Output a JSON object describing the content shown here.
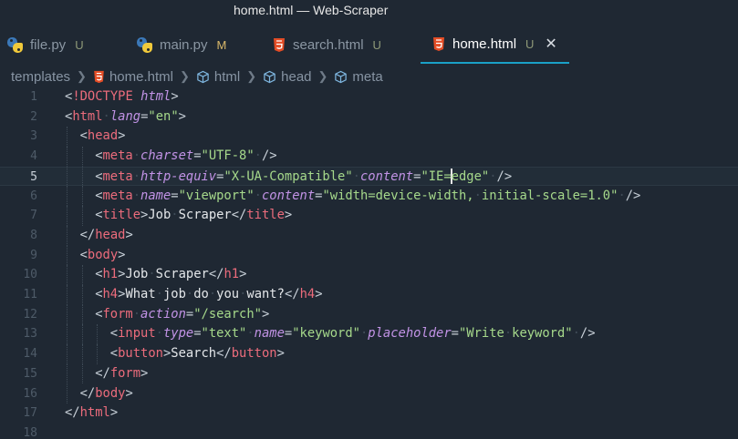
{
  "window": {
    "title": "home.html — Web-Scraper"
  },
  "tabs": [
    {
      "label": "file.py",
      "status": "U",
      "icon": "python-icon"
    },
    {
      "label": "main.py",
      "status": "M",
      "icon": "python-icon"
    },
    {
      "label": "search.html",
      "status": "U",
      "icon": "html5-icon"
    },
    {
      "label": "home.html",
      "status": "U",
      "icon": "html5-icon",
      "active": true
    }
  ],
  "breadcrumb": [
    "templates",
    "home.html",
    "html",
    "head",
    "meta"
  ],
  "colors": {
    "tag": "#ec6c7c",
    "attribute": "#c293e6",
    "string": "#a6d98b",
    "active_tab_underline": "#1aa0c7",
    "html5_orange": "#e44d26"
  },
  "editor": {
    "current_line": 5,
    "lines": [
      {
        "n": "1",
        "indent": 0,
        "tokens": [
          [
            "p",
            "<"
          ],
          [
            "t",
            "!DOCTYPE"
          ],
          [
            "p",
            " "
          ],
          [
            "a",
            "html"
          ],
          [
            "p",
            ">"
          ]
        ]
      },
      {
        "n": "2",
        "indent": 0,
        "tokens": [
          [
            "p",
            "<"
          ],
          [
            "t",
            "html"
          ],
          [
            "ws",
            "·"
          ],
          [
            "a",
            "lang"
          ],
          [
            "p",
            "="
          ],
          [
            "s",
            "\"en\""
          ],
          [
            "p",
            ">"
          ]
        ]
      },
      {
        "n": "3",
        "indent": 1,
        "tokens": [
          [
            "p",
            "<"
          ],
          [
            "t",
            "head"
          ],
          [
            "p",
            ">"
          ]
        ]
      },
      {
        "n": "4",
        "indent": 2,
        "tokens": [
          [
            "p",
            "<"
          ],
          [
            "t",
            "meta"
          ],
          [
            "ws",
            "·"
          ],
          [
            "a",
            "charset"
          ],
          [
            "p",
            "="
          ],
          [
            "s",
            "\"UTF-8\""
          ],
          [
            "ws",
            "·"
          ],
          [
            "p",
            "/>"
          ]
        ]
      },
      {
        "n": "5",
        "indent": 2,
        "tokens": [
          [
            "p",
            "<"
          ],
          [
            "t",
            "meta"
          ],
          [
            "ws",
            "·"
          ],
          [
            "a",
            "http-equiv"
          ],
          [
            "p",
            "="
          ],
          [
            "s",
            "\"X-UA-Compatible\""
          ],
          [
            "ws",
            "·"
          ],
          [
            "a",
            "content"
          ],
          [
            "p",
            "="
          ],
          [
            "s",
            "\"IE="
          ],
          [
            "cursor",
            ""
          ],
          [
            "s",
            "edge\""
          ],
          [
            "ws",
            "·"
          ],
          [
            "p",
            "/>"
          ]
        ]
      },
      {
        "n": "6",
        "indent": 2,
        "tokens": [
          [
            "p",
            "<"
          ],
          [
            "t",
            "meta"
          ],
          [
            "ws",
            "·"
          ],
          [
            "a",
            "name"
          ],
          [
            "p",
            "="
          ],
          [
            "s",
            "\"viewport\""
          ],
          [
            "ws",
            "·"
          ],
          [
            "a",
            "content"
          ],
          [
            "p",
            "="
          ],
          [
            "s",
            "\"width=device-width,"
          ],
          [
            "ws",
            "·"
          ],
          [
            "s",
            "initial-scale=1.0\""
          ],
          [
            "ws",
            "·"
          ],
          [
            "p",
            "/>"
          ]
        ]
      },
      {
        "n": "7",
        "indent": 2,
        "tokens": [
          [
            "p",
            "<"
          ],
          [
            "t",
            "title"
          ],
          [
            "p",
            ">"
          ],
          [
            "tx",
            "Job"
          ],
          [
            "ws",
            "·"
          ],
          [
            "tx",
            "Scraper"
          ],
          [
            "p",
            "</"
          ],
          [
            "t",
            "title"
          ],
          [
            "p",
            ">"
          ]
        ]
      },
      {
        "n": "8",
        "indent": 1,
        "tokens": [
          [
            "p",
            "</"
          ],
          [
            "t",
            "head"
          ],
          [
            "p",
            ">"
          ]
        ]
      },
      {
        "n": "9",
        "indent": 1,
        "tokens": [
          [
            "p",
            "<"
          ],
          [
            "t",
            "body"
          ],
          [
            "p",
            ">"
          ]
        ]
      },
      {
        "n": "10",
        "indent": 2,
        "tokens": [
          [
            "p",
            "<"
          ],
          [
            "t",
            "h1"
          ],
          [
            "p",
            ">"
          ],
          [
            "tx",
            "Job"
          ],
          [
            "ws",
            "·"
          ],
          [
            "tx",
            "Scraper"
          ],
          [
            "p",
            "</"
          ],
          [
            "t",
            "h1"
          ],
          [
            "p",
            ">"
          ]
        ]
      },
      {
        "n": "11",
        "indent": 2,
        "tokens": [
          [
            "p",
            "<"
          ],
          [
            "t",
            "h4"
          ],
          [
            "p",
            ">"
          ],
          [
            "tx",
            "What"
          ],
          [
            "ws",
            "·"
          ],
          [
            "tx",
            "job"
          ],
          [
            "ws",
            "·"
          ],
          [
            "tx",
            "do"
          ],
          [
            "ws",
            "·"
          ],
          [
            "tx",
            "you"
          ],
          [
            "ws",
            "·"
          ],
          [
            "tx",
            "want?"
          ],
          [
            "p",
            "</"
          ],
          [
            "t",
            "h4"
          ],
          [
            "p",
            ">"
          ]
        ]
      },
      {
        "n": "12",
        "indent": 2,
        "tokens": [
          [
            "p",
            "<"
          ],
          [
            "t",
            "form"
          ],
          [
            "ws",
            "·"
          ],
          [
            "a",
            "action"
          ],
          [
            "p",
            "="
          ],
          [
            "s",
            "\"/search\""
          ],
          [
            "p",
            ">"
          ]
        ]
      },
      {
        "n": "13",
        "indent": 3,
        "tokens": [
          [
            "p",
            "<"
          ],
          [
            "t",
            "input"
          ],
          [
            "ws",
            "·"
          ],
          [
            "a",
            "type"
          ],
          [
            "p",
            "="
          ],
          [
            "s",
            "\"text\""
          ],
          [
            "ws",
            "·"
          ],
          [
            "a",
            "name"
          ],
          [
            "p",
            "="
          ],
          [
            "s",
            "\"keyword\""
          ],
          [
            "ws",
            "·"
          ],
          [
            "a",
            "placeholder"
          ],
          [
            "p",
            "="
          ],
          [
            "s",
            "\"Write"
          ],
          [
            "ws",
            "·"
          ],
          [
            "s",
            "keyword\""
          ],
          [
            "ws",
            "·"
          ],
          [
            "p",
            "/>"
          ]
        ]
      },
      {
        "n": "14",
        "indent": 3,
        "tokens": [
          [
            "p",
            "<"
          ],
          [
            "t",
            "button"
          ],
          [
            "p",
            ">"
          ],
          [
            "tx",
            "Search"
          ],
          [
            "p",
            "</"
          ],
          [
            "t",
            "button"
          ],
          [
            "p",
            ">"
          ]
        ]
      },
      {
        "n": "15",
        "indent": 2,
        "tokens": [
          [
            "p",
            "</"
          ],
          [
            "t",
            "form"
          ],
          [
            "p",
            ">"
          ]
        ]
      },
      {
        "n": "16",
        "indent": 1,
        "tokens": [
          [
            "p",
            "</"
          ],
          [
            "t",
            "body"
          ],
          [
            "p",
            ">"
          ]
        ]
      },
      {
        "n": "17",
        "indent": 0,
        "tokens": [
          [
            "p",
            "</"
          ],
          [
            "t",
            "html"
          ],
          [
            "p",
            ">"
          ]
        ]
      },
      {
        "n": "18",
        "indent": 0,
        "tokens": []
      }
    ]
  }
}
